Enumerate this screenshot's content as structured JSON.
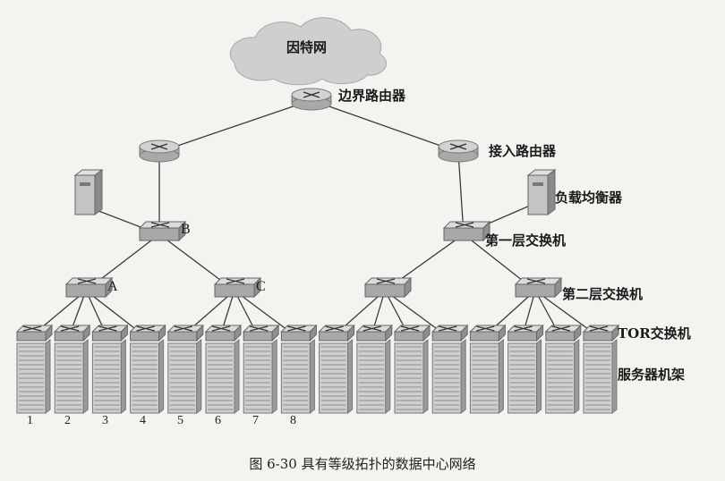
{
  "labels": {
    "internet": "因特网",
    "border_router": "边界路由器",
    "access_router": "接入路由器",
    "load_balancer": "负载均衡器",
    "tier1_switch": "第一层交换机",
    "tier2_switch": "第二层交换机",
    "tor_switch": "TOR交换机",
    "server_racks": "服务器机架",
    "switch_b": "B",
    "switch_a": "A",
    "switch_c": "C"
  },
  "rack_numbers": [
    "1",
    "2",
    "3",
    "4",
    "5",
    "6",
    "7",
    "8"
  ],
  "caption": "图 6-30    具有等级拓扑的数据中心网络",
  "colors": {
    "cloud": "#cfcfcf",
    "device": "#bdbdbd",
    "line": "#3a3a3a"
  }
}
